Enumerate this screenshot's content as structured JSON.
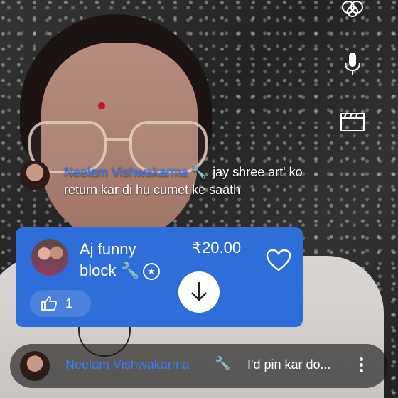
{
  "chat": {
    "author": "Neelam Vishwakarma",
    "message": "jay shree art' ko return kar di hu cumet ke saath"
  },
  "superchat": {
    "author_line1": "Aj funny",
    "author_line2": "block",
    "amount": "₹20.00",
    "like_count": "1"
  },
  "pinned": {
    "author": "Neelam Vishwakarma",
    "message": "I'd pin kar do..."
  },
  "icons": {
    "effects": "effects-icon",
    "mic": "mic-icon",
    "clapperboard": "clapperboard-icon",
    "wrench": "wrench-icon",
    "verified": "verified-icon",
    "heart": "heart-icon",
    "thumbs_up": "thumbs-up-icon",
    "arrow_down": "arrow-down-icon",
    "more": "more-vert-icon"
  },
  "colors": {
    "accent_blue": "#3d7df6",
    "card_blue": "#2f6ed8"
  }
}
